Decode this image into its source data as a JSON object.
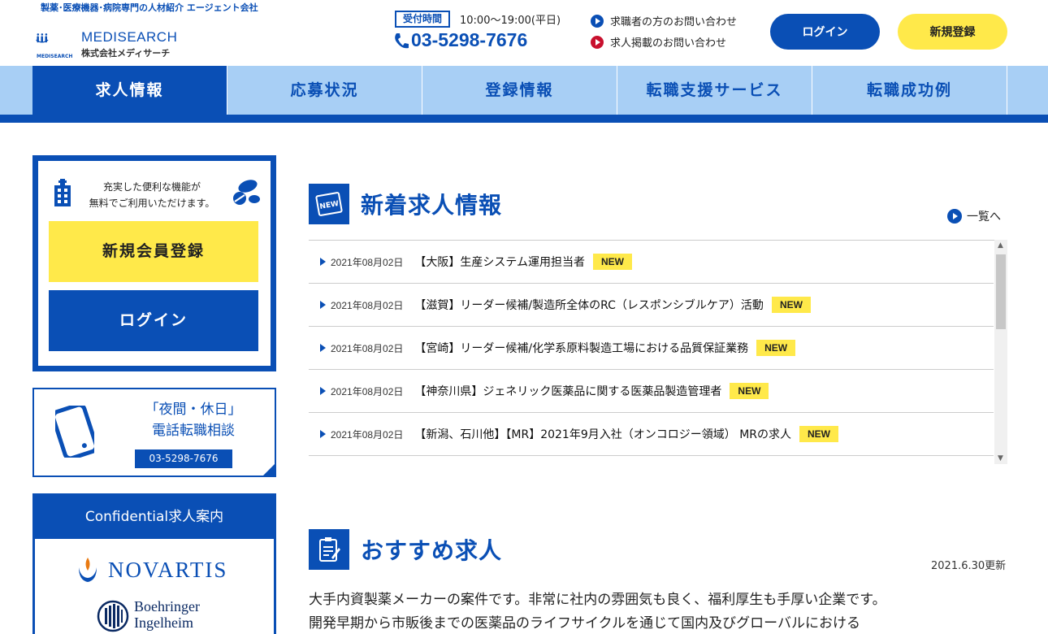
{
  "header": {
    "tagline": "製薬･医療機器･病院専門の人材紹介 エージェント会社",
    "logo_name": "MEDISEARCH",
    "logo_company": "株式会社メディサーチ",
    "logo_mark_label": "MEDISEARCH",
    "hours_badge": "受付時間",
    "hours": "10:00〜19:00(平日)",
    "phone": "03-5298-7676",
    "contact_jobseeker": "求職者の方のお問い合わせ",
    "contact_employer": "求人掲載のお問い合わせ",
    "login_label": "ログイン",
    "register_label": "新規登録"
  },
  "nav": {
    "items": [
      {
        "label": "求人情報"
      },
      {
        "label": "応募状況"
      },
      {
        "label": "登録情報"
      },
      {
        "label": "転職支援サービス"
      },
      {
        "label": "転職成功例"
      }
    ]
  },
  "sidebar": {
    "message_line1": "充実した便利な機能が",
    "message_line2": "無料でご利用いただけます。",
    "register_label": "新規会員登録",
    "login_label": "ログイン",
    "consult_line1": "「夜間・休日」",
    "consult_line2": "電話転職相談",
    "consult_phone": "03-5298-7676",
    "confidential_title": "Confidential求人案内",
    "company1": "NOVARTIS",
    "company2_line1": "Boehringer",
    "company2_line2": "Ingelheim"
  },
  "new_jobs": {
    "title": "新着求人情報",
    "icon_label": "NEW",
    "more_label": "一覧へ",
    "items": [
      {
        "date": "2021年08月02日",
        "title": "【大阪】生産システム運用担当者",
        "badge": "NEW"
      },
      {
        "date": "2021年08月02日",
        "title": "【滋賀】リーダー候補/製造所全体のRC（レスポンシブルケア）活動",
        "badge": "NEW"
      },
      {
        "date": "2021年08月02日",
        "title": "【宮崎】リーダー候補/化学系原料製造工場における品質保証業務",
        "badge": "NEW"
      },
      {
        "date": "2021年08月02日",
        "title": "【神奈川県】ジェネリック医薬品に関する医薬品製造管理者",
        "badge": "NEW"
      },
      {
        "date": "2021年08月02日",
        "title": "【新潟、石川他】【MR】2021年9月入社（オンコロジー領域） MRの求人",
        "badge": "NEW"
      }
    ]
  },
  "recommended": {
    "title": "おすすめ求人",
    "updated": "2021.6.30更新",
    "line1": "大手内資製薬メーカーの案件です。非常に社内の雰囲気も良く、福利厚生も手厚い企業です。",
    "line2": "開発早期から市販後までの医薬品のライフサイクルを通じて国内及びグローバルにおける"
  },
  "colors": {
    "primary": "#0a4fb5",
    "nav_bg": "#a8cff5",
    "accent_yellow": "#ffe94a",
    "employer_dot": "#c8102e"
  }
}
